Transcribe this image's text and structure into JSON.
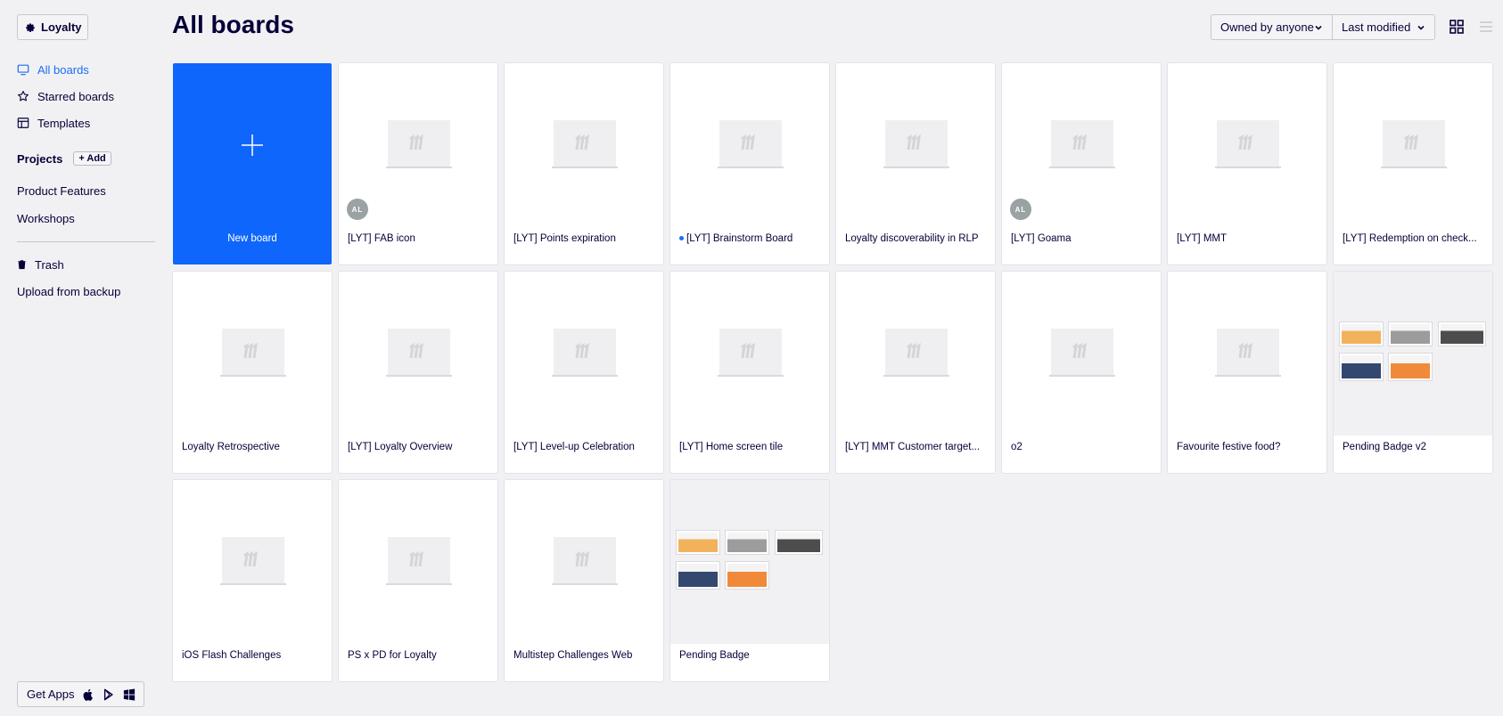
{
  "sidebar": {
    "team_label": "Loyalty",
    "nav": [
      {
        "label": "All boards",
        "icon": "board-icon",
        "active": true
      },
      {
        "label": "Starred boards",
        "icon": "star-icon",
        "active": false
      },
      {
        "label": "Templates",
        "icon": "templates-icon",
        "active": false
      }
    ],
    "projects_label": "Projects",
    "add_label": "+ Add",
    "projects": [
      "Product Features",
      "Workshops"
    ],
    "trash_label": "Trash",
    "upload_label": "Upload from backup",
    "get_apps_label": "Get Apps"
  },
  "header": {
    "title": "All boards",
    "owner_filter": "Owned by anyone",
    "sort": "Last modified"
  },
  "boards": [
    {
      "title": "New board",
      "type": "new"
    },
    {
      "title": "[LYT] FAB icon",
      "avatar": "AL"
    },
    {
      "title": "[LYT] Points expiration"
    },
    {
      "title": "[LYT] Brainstorm Board",
      "dot": true
    },
    {
      "title": "Loyalty discoverability in RLP"
    },
    {
      "title": "[LYT] Goama",
      "avatar": "AL"
    },
    {
      "title": "[LYT] MMT"
    },
    {
      "title": "[LYT] Redemption on check..."
    },
    {
      "title": "Loyalty Retrospective"
    },
    {
      "title": "[LYT] Loyalty Overview"
    },
    {
      "title": "[LYT] Level-up Celebration"
    },
    {
      "title": "[LYT] Home screen tile"
    },
    {
      "title": "[LYT] MMT Customer target..."
    },
    {
      "title": "o2"
    },
    {
      "title": "Favourite festive food?"
    },
    {
      "title": "Pending Badge v2",
      "preview": true
    },
    {
      "title": "iOS Flash Challenges"
    },
    {
      "title": "PS x PD for Loyalty"
    },
    {
      "title": "Multistep Challenges Web"
    },
    {
      "title": "Pending Badge",
      "preview": true
    }
  ],
  "colors": {
    "accent": "#1a6ef5",
    "new_board_bg": "#0f66fc",
    "background": "#f1f1f4",
    "text": "#050038"
  }
}
